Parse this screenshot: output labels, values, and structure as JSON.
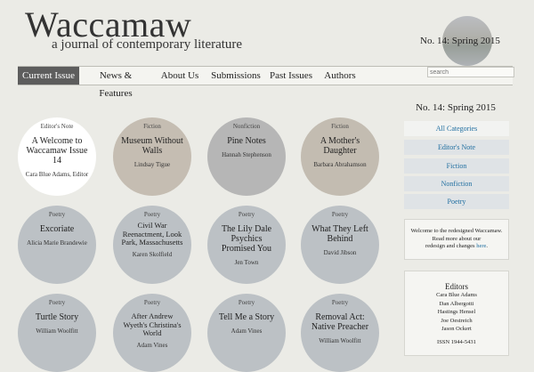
{
  "header": {
    "site_title": "Waccamaw",
    "tagline": "a journal of contemporary literature",
    "issue_label": "No. 14: Spring 2015"
  },
  "nav": {
    "items": [
      {
        "label": "Current Issue"
      },
      {
        "label": "News & Features"
      },
      {
        "label": "About Us"
      },
      {
        "label": "Submissions"
      },
      {
        "label": "Past Issues"
      },
      {
        "label": "Authors"
      }
    ],
    "search_placeholder": "search"
  },
  "entries": [
    {
      "category": "Editor's Note",
      "title": "A Welcome to Waccamaw Issue 14",
      "author": "Cara Blue Adams, Editor",
      "color": "#ffffff"
    },
    {
      "category": "Fiction",
      "title": "Museum Without Walls",
      "author": "Lindsay Tigue",
      "color": "#c5bdb2"
    },
    {
      "category": "Nonfiction",
      "title": "Pine Notes",
      "author": "Hannah Stephenson",
      "color": "#b6b6b6"
    },
    {
      "category": "Fiction",
      "title": "A Mother's Daughter",
      "author": "Barbara Abrahamson",
      "color": "#c3bcb1"
    },
    {
      "category": "Poetry",
      "title": "Excoriate",
      "author": "Alicia Marie Brandewie",
      "color": "#bcc1c5"
    },
    {
      "category": "Poetry",
      "title": "Civil War Reenactment, Look Park, Massachusetts",
      "author": "Karen Skolfield",
      "color": "#bcc1c5"
    },
    {
      "category": "Poetry",
      "title": "The Lily Dale Psychics Promised You",
      "author": "Jen Town",
      "color": "#bcc1c5"
    },
    {
      "category": "Poetry",
      "title": "What They Left Behind",
      "author": "David Jibson",
      "color": "#bcc1c5"
    },
    {
      "category": "Poetry",
      "title": "Turtle Story",
      "author": "William Woolfitt",
      "color": "#bcc1c5"
    },
    {
      "category": "Poetry",
      "title": "After Andrew Wyeth's Christina's World",
      "author": "Adam Vines",
      "color": "#bcc1c5"
    },
    {
      "category": "Poetry",
      "title": "Tell Me a Story",
      "author": "Adam Vines",
      "color": "#bcc1c5"
    },
    {
      "category": "Poetry",
      "title": "Removal Act: Native Preacher",
      "author": "William Woolfitt",
      "color": "#bcc1c5"
    }
  ],
  "sidebar": {
    "issue_heading": "No. 14: Spring 2015",
    "categories": [
      {
        "label": "All Categories"
      },
      {
        "label": "Editor's Note"
      },
      {
        "label": "Fiction"
      },
      {
        "label": "Nonfiction"
      },
      {
        "label": "Poetry"
      }
    ],
    "welcome": {
      "line1": "Welcome to the redesigned Waccamaw.",
      "line2": "Read more about our",
      "line3_pre": "redesign and changes ",
      "link": "here",
      "line3_post": "."
    },
    "editors": {
      "heading": "Editors",
      "names": [
        "Cara Blue Adams",
        "Dan Albergotti",
        "Hastings Hensel",
        "Joe Oestreich",
        "Jason Ockert"
      ],
      "issn": "ISSN 1944-5431"
    }
  },
  "colors": {
    "nav_active_bg": "#5d5d5d",
    "link": "#1f6ea0",
    "background": "#ebebe6"
  }
}
